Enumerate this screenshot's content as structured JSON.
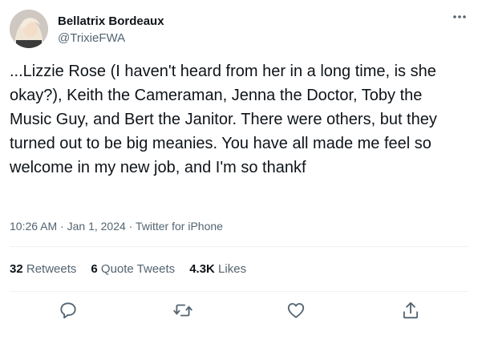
{
  "author": {
    "display_name": "Bellatrix Bordeaux",
    "handle": "@TrixieFWA",
    "avatar_icon": "profile-photo"
  },
  "more_icon": "more-horizontal-icon",
  "tweet": {
    "text": "...Lizzie Rose (I haven't heard from her in a long time, is she okay?), Keith the Cameraman, Jenna the Doctor, Toby the Music Guy, and Bert the Janitor. There were others, but they turned out to be big meanies. You have all made me feel so welcome in my new job, and I'm so thankf",
    "time": "10:26 AM",
    "date": "Jan 1, 2024",
    "source": "Twitter for iPhone",
    "separator": " · "
  },
  "stats": {
    "retweets_count": "32",
    "retweets_label": "Retweets",
    "quotes_count": "6",
    "quotes_label": "Quote Tweets",
    "likes_count": "4.3K",
    "likes_label": "Likes"
  },
  "actions": {
    "reply_icon": "reply-icon",
    "retweet_icon": "retweet-icon",
    "like_icon": "heart-icon",
    "share_icon": "share-icon"
  },
  "colors": {
    "text_primary": "#0f1419",
    "text_secondary": "#536471",
    "divider": "#eff3f4"
  }
}
